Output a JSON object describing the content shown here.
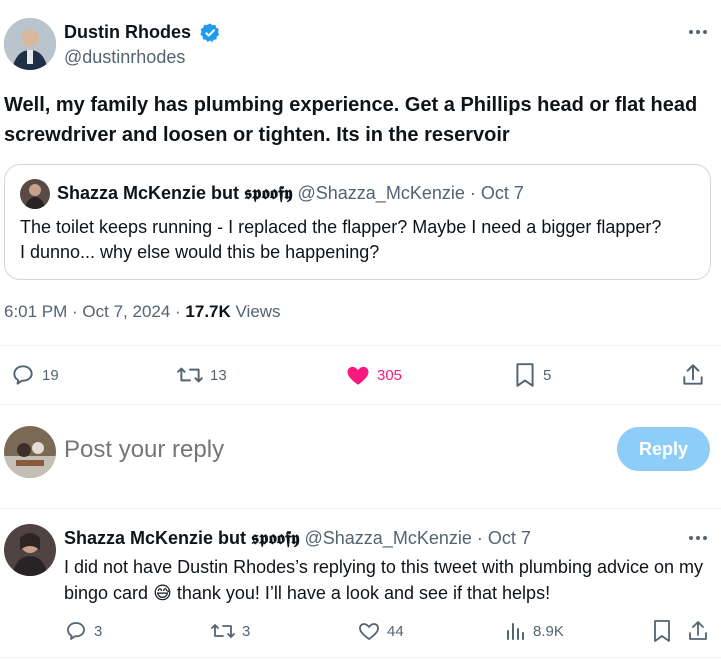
{
  "main_tweet": {
    "author_name": "Dustin Rhodes",
    "author_handle": "@dustinrhodes",
    "text": "Well, my family has plumbing experience. Get a Phillips head or flat head screwdriver and loosen or tighten. Its in the reservoir",
    "timestamp": "6:01 PM · Oct 7, 2024 · ",
    "views_count": "17.7K",
    "views_label": " Views",
    "more_icon": "ellipsis-icon",
    "verified_color": "#1d9bf0"
  },
  "quoted_tweet": {
    "author_name": "Shazza McKenzie but 𝖘𝖕𝖔𝖔𝖋𝖞",
    "author_handle": "@Shazza_McKenzie",
    "date": "· Oct 7",
    "text": "The toilet keeps running - I replaced the flapper? Maybe I need a bigger flapper? I dunno... why else would this be happening?"
  },
  "actions": {
    "replies": "19",
    "retweets": "13",
    "likes": "305",
    "bookmarks": "5",
    "like_color": "#f91880"
  },
  "reply_composer": {
    "placeholder": "Post your reply",
    "button_label": "Reply"
  },
  "reply_tweet": {
    "author_name": "Shazza McKenzie but 𝖘𝖕𝖔𝖔𝖋𝖞",
    "author_handle": "@Shazza_McKenzie",
    "date": "· Oct 7",
    "text_part1": "I did not have Dustin Rhodes’s replying to this tweet with plumbing advice on my bingo card ",
    "emoji": "😅",
    "text_part2": " thank you! I’ll have a look and see if that helps!",
    "replies": "3",
    "retweets": "3",
    "likes": "44",
    "views": "8.9K"
  }
}
